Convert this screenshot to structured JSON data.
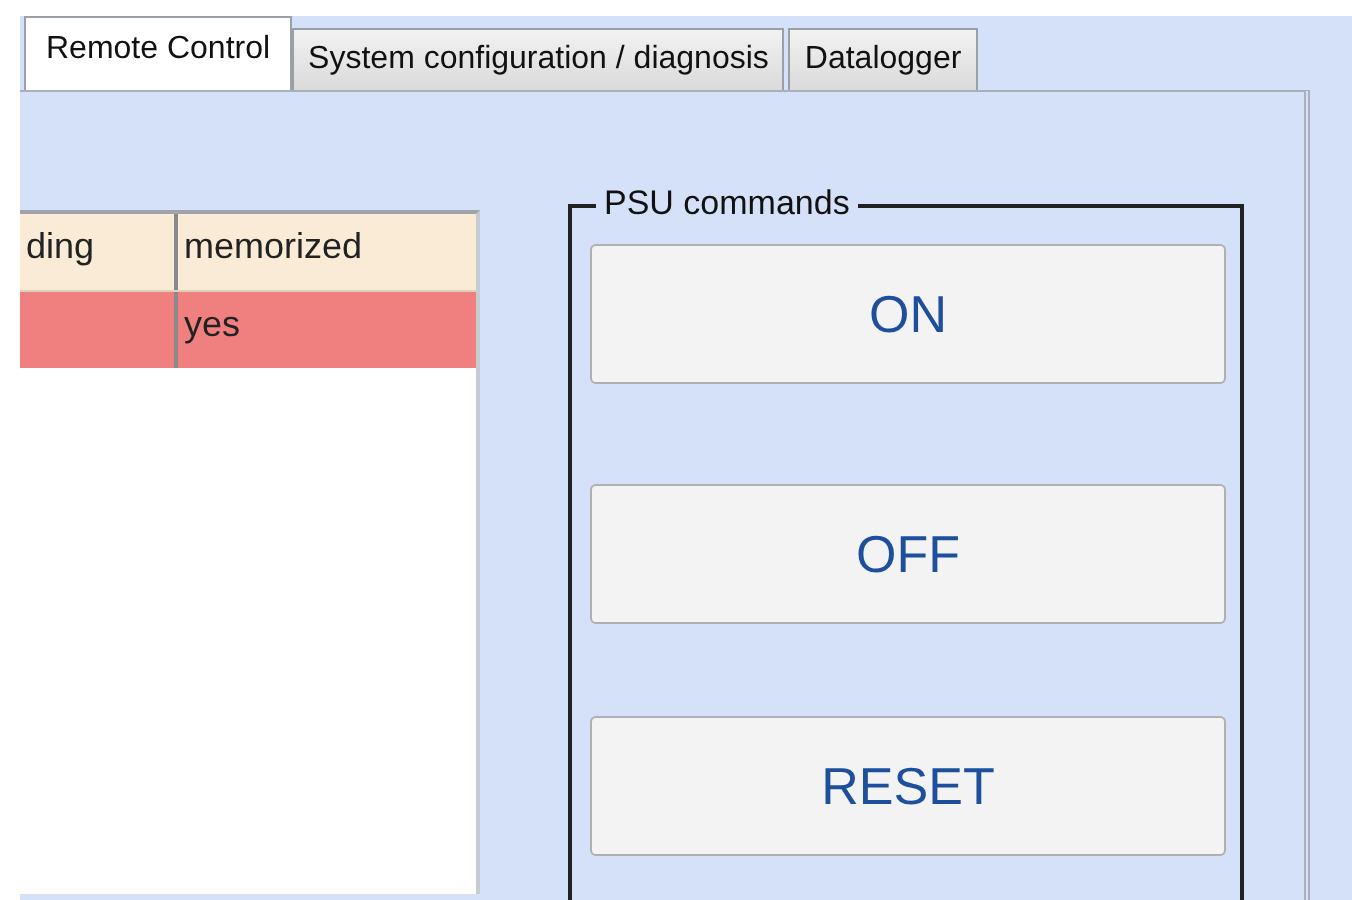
{
  "tabs": [
    {
      "label": "Remote Control",
      "selected": true
    },
    {
      "label": "System configuration / diagnosis",
      "selected": false
    },
    {
      "label": "Datalogger",
      "selected": false
    }
  ],
  "table": {
    "columns": [
      "ding",
      "memorized"
    ],
    "rows": [
      {
        "selected": true,
        "cells": [
          null,
          "yes"
        ]
      }
    ]
  },
  "psu_group": {
    "title": "PSU commands",
    "buttons": [
      "ON",
      "OFF",
      "RESET"
    ]
  }
}
